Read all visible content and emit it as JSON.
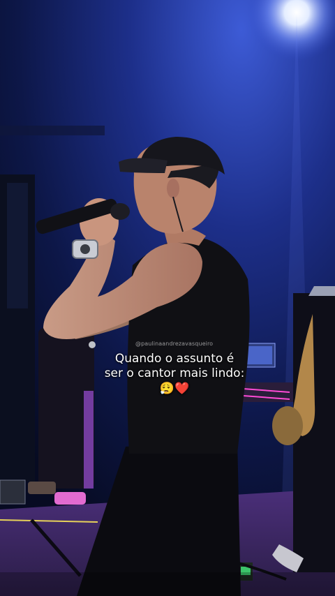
{
  "overlay": {
    "watermark": "@paulinaandrezavasqueiro",
    "caption_line1": "Quando o assunto é",
    "caption_line2": "ser o cantor mais lindo:",
    "caption_emoji": "😮‍💨❤️"
  },
  "colors": {
    "stage_light": "#dfe9ff",
    "background": "#0a1230",
    "floor_accent": "#e7d25a"
  }
}
